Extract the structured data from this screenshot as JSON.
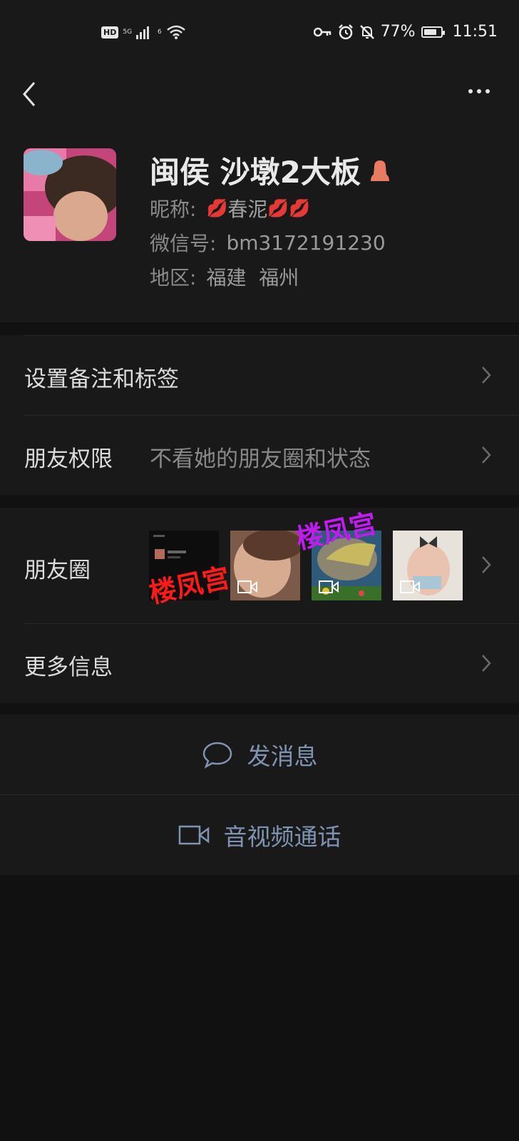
{
  "status_bar": {
    "hd": "HD",
    "network": "5G",
    "wifi_tag": "6",
    "battery_percent": "77%",
    "battery_level": 0.77,
    "time": "11:51"
  },
  "profile": {
    "name": "闽侯 沙墩2大板",
    "nickname_label": "昵称:",
    "nickname_value": "春泥",
    "wechat_id_label": "微信号:",
    "wechat_id_value": "bm3172191230",
    "region_label": "地区:",
    "region_value": "福建  福州"
  },
  "menu": {
    "remark_tags": "设置备注和标签",
    "friend_permission_label": "朋友权限",
    "friend_permission_value": "不看她的朋友圈和状态",
    "moments_label": "朋友圈",
    "more_info": "更多信息"
  },
  "watermarks": {
    "text_1": "楼凤宫",
    "text_2": "楼凤宫"
  },
  "actions": {
    "send_message": "发消息",
    "av_call": "音视频通话"
  },
  "colors": {
    "background": "#111111",
    "panel": "#191919",
    "action_text": "#7f93b3",
    "watermark_red": "#ff1a1a",
    "watermark_purple": "#c01cf0"
  }
}
